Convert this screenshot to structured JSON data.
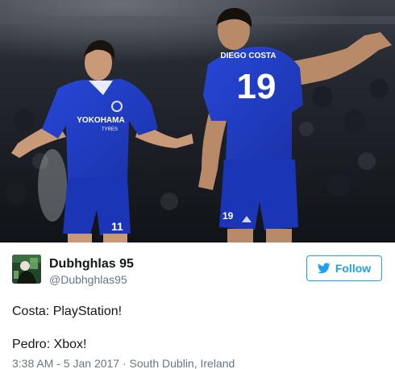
{
  "photo": {
    "left_player": {
      "shirt_sponsor": "YOKOHAMA",
      "shirt_sponsor_sub": "TYRES",
      "short_number": "11"
    },
    "right_player": {
      "shirt_name": "DIEGO COSTA",
      "shirt_number": "19",
      "short_number": "19"
    },
    "colors": {
      "kit_blue": "#1e3fc8",
      "kit_trim": "#ffffff"
    }
  },
  "tweet": {
    "display_name": "Dubhghlas 95",
    "handle": "@Dubhghlas95",
    "follow_label": "Follow",
    "lines": [
      "Costa: PlayStation!",
      "Pedro: Xbox!"
    ],
    "timestamp": "3:38 AM - 5 Jan 2017",
    "separator": "·",
    "location": "South Dublin, Ireland",
    "colors": {
      "accent": "#1da1f2",
      "secondary_text": "#657786",
      "primary_text": "#14171a"
    }
  }
}
